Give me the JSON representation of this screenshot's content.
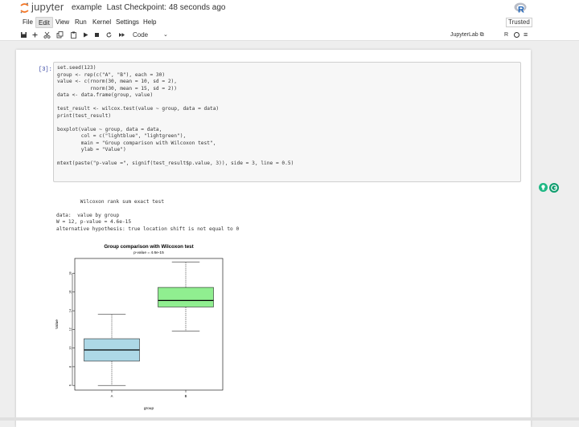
{
  "header": {
    "logo_text": "jupyter",
    "notebook_name": "example",
    "checkpoint": "Last Checkpoint: 48 seconds ago",
    "kernel_logo": "R"
  },
  "menu": {
    "items": [
      "File",
      "Edit",
      "View",
      "Run",
      "Kernel",
      "Settings",
      "Help"
    ],
    "active": "Edit",
    "trusted_label": "Trusted"
  },
  "toolbar": {
    "icons": [
      "save-icon",
      "add-cell-icon",
      "cut-icon",
      "copy-icon",
      "paste-icon",
      "run-icon",
      "stop-icon",
      "restart-icon",
      "fast-forward-icon"
    ],
    "cell_type": "Code",
    "jupyterlab_link": "JupyterLab",
    "kernel_name": "R"
  },
  "cell": {
    "prompt": "[3]:",
    "code_lines": [
      "set.seed(123)",
      "group <- rep(c(\"A\", \"B\"), each = 30)",
      "value <- c(rnorm(30, mean = 10, sd = 2),",
      "           rnorm(30, mean = 15, sd = 2))",
      "data <- data.frame(group, value)",
      "",
      "test_result <- wilcox.test(value ~ group, data = data)",
      "print(test_result)",
      "",
      "boxplot(value ~ group, data = data,",
      "        col = c(\"lightblue\", \"lightgreen\"),",
      "        main = \"Group comparison with Wilcoxon test\",",
      "        ylab = \"Value\")",
      "",
      "mtext(paste(\"p-value =\", signif(test_result$p.value, 3)), side = 3, line = 0.5)"
    ],
    "output_lines": [
      "",
      "        Wilcoxon rank sum exact test",
      "",
      "data:  value by group",
      "W = 12, p-value = 4.6e-15",
      "alternative hypothesis: true location shift is not equal to 0"
    ]
  },
  "chart_data": {
    "type": "box",
    "title": "Group comparison with Wilcoxon test",
    "subtitle": "p-value = 4.6e-15",
    "xlabel": "group",
    "ylabel": "Value",
    "categories": [
      "A",
      "B"
    ],
    "colors": [
      "#add8e6",
      "#90ee90"
    ],
    "yticks": [
      6,
      8,
      10,
      12,
      14,
      16,
      18
    ],
    "ylim": [
      5.5,
      19.6
    ],
    "boxes": [
      {
        "name": "A",
        "min": 6.0,
        "q1": 8.6,
        "median": 9.8,
        "q3": 11.0,
        "max": 13.6
      },
      {
        "name": "B",
        "min": 11.8,
        "q1": 14.4,
        "median": 15.1,
        "q3": 16.5,
        "max": 19.2
      }
    ]
  }
}
